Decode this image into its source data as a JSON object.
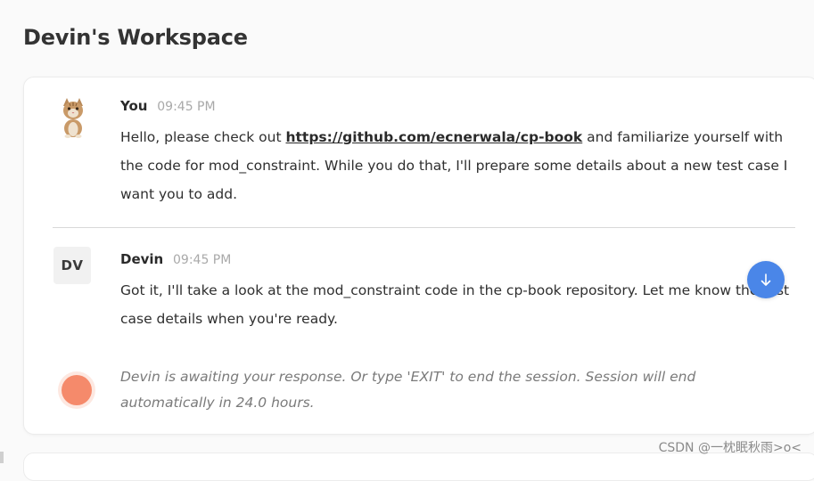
{
  "header": {
    "title": "Devin's Workspace"
  },
  "messages": [
    {
      "sender": "You",
      "time": "09:45 PM",
      "avatar_icon": "cat-avatar-icon",
      "text_before_link": "Hello, please check out ",
      "link": "https://github.com/ecnerwala/cp-book",
      "text_after_link": " and familiarize yourself with the code for mod_constraint. While you do that, I'll prepare some details about a new test case I want you to add."
    },
    {
      "sender": "Devin",
      "time": "09:45 PM",
      "avatar_initials": "DV",
      "text": "Got it, I'll take a look at the mod_constraint code in the cp-book repository. Let me know the test case details when you're ready."
    }
  ],
  "status": {
    "text": "Devin is awaiting your response. Or type 'EXIT' to end the session. Session will end automatically in 24.0 hours.",
    "dot_color": "#f58a6b"
  },
  "scroll_button": {
    "icon": "arrow-down-icon",
    "color": "#4a86e8"
  },
  "watermark": "CSDN @一枕眠秋雨>o<"
}
